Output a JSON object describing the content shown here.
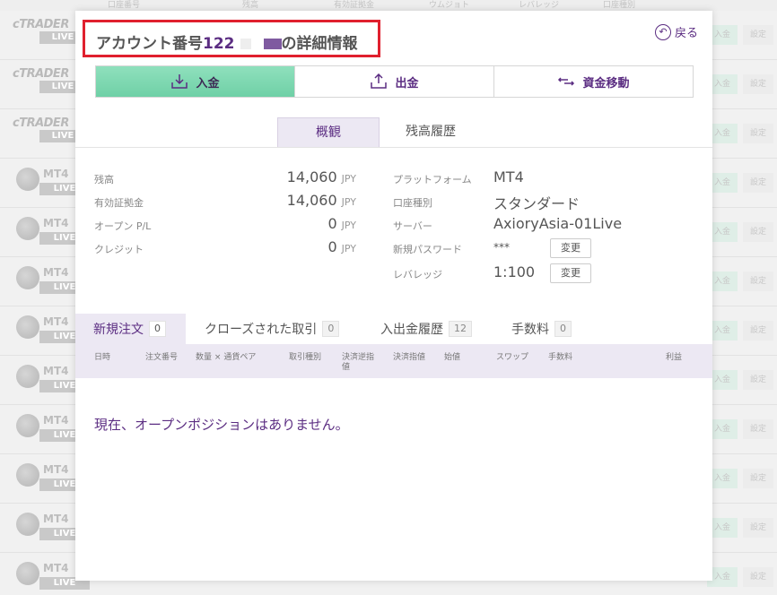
{
  "background": {
    "header_labels": [
      "口座番号",
      "残高",
      "有効証拠金",
      "ウムジョト",
      "レバレッジ",
      "口座種別"
    ],
    "row_button_deposit": "入金",
    "row_button_settings": "設定",
    "ctrader_brand": "cTRADER",
    "mt4_name": "MT4",
    "live_badge": "LIVE"
  },
  "modal": {
    "title_prefix": "アカウント番号",
    "title_number": "122",
    "title_suffix": "の詳細情報",
    "back_label": "戻る",
    "actions": [
      {
        "label": "入金",
        "icon": "download-tray-icon"
      },
      {
        "label": "出金",
        "icon": "upload-tray-icon"
      },
      {
        "label": "資金移動",
        "icon": "transfer-arrows-icon"
      }
    ],
    "subtabs": [
      "概観",
      "残高履歴"
    ],
    "balances": [
      {
        "label": "残高",
        "value": "14,060",
        "unit": "JPY"
      },
      {
        "label": "有効証拠金",
        "value": "14,060",
        "unit": "JPY"
      },
      {
        "label": "オープン P/L",
        "value": "0",
        "unit": "JPY"
      },
      {
        "label": "クレジット",
        "value": "0",
        "unit": "JPY"
      }
    ],
    "account_info": {
      "platform_label": "プラットフォーム",
      "platform_value": "MT4",
      "type_label": "口座種別",
      "type_value": "スタンダード",
      "server_label": "サーバー",
      "server_value": "AxioryAsia-01Live",
      "password_label": "新規パスワード",
      "password_value": "***",
      "leverage_label": "レバレッジ",
      "leverage_value": "1:100",
      "change_label": "変更"
    },
    "order_tabs": [
      {
        "label": "新規注文",
        "count": "0"
      },
      {
        "label": "クローズされた取引",
        "count": "0"
      },
      {
        "label": "入出金履歴",
        "count": "12"
      },
      {
        "label": "手数料",
        "count": "0"
      }
    ],
    "table_headers": {
      "date": "日時",
      "order_no": "注文番号",
      "qty_a": "数量",
      "qty_sep": "×",
      "qty_b": "通貨ペア",
      "trade_type": "取引種別",
      "sl_a": "決済逆指",
      "sl_b": "値",
      "tp": "決済指値",
      "open_price": "始値",
      "swap": "スワップ",
      "fee": "手数料",
      "profit": "利益"
    },
    "empty_message": "現在、オープンポジションはありません。"
  }
}
